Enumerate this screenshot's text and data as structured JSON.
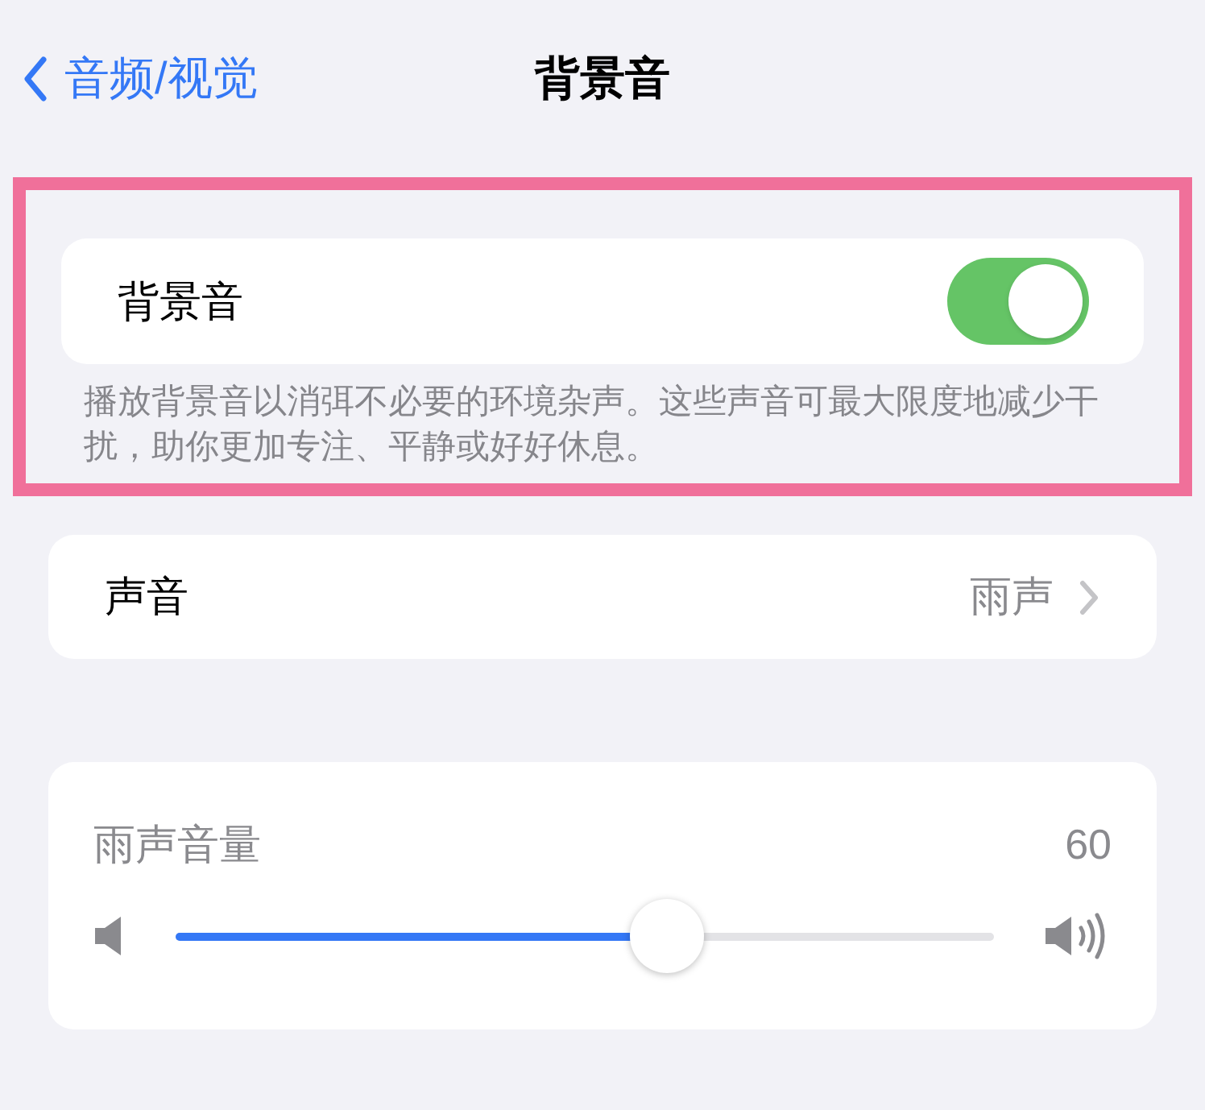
{
  "nav": {
    "back_label": "音频/视觉",
    "title": "背景音"
  },
  "background_sounds": {
    "highlighted": true,
    "label": "背景音",
    "on": true,
    "description": "播放背景音以消弭不必要的环境杂声。这些声音可最大限度地减少干扰，助你更加专注、平静或好好休息。"
  },
  "sound": {
    "label": "声音",
    "value": "雨声"
  },
  "volume": {
    "label": "雨声音量",
    "reading": "60",
    "level": 0.6
  }
}
